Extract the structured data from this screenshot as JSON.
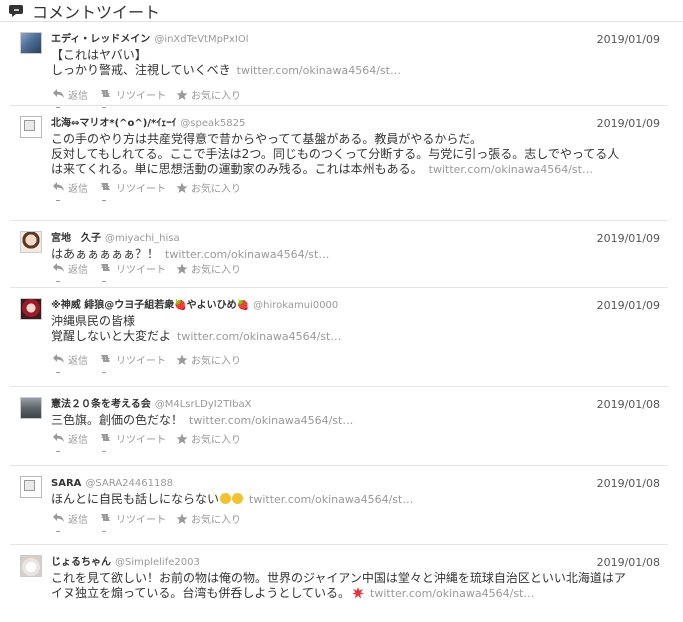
{
  "header": {
    "title": "コメントツイート",
    "icon": "speech-bubble-icon"
  },
  "actions": {
    "reply": "返信",
    "retweet": "リツイート",
    "favorite": "お気に入り"
  },
  "tweets": [
    {
      "name": "エディ・レッドメイン",
      "handle": "@inXdTeVtMpPxIOl",
      "date": "2019/01/09",
      "lines": [
        "【これはヤバい】",
        "しっかり警戒、注視していくべき"
      ],
      "link": "twitter.com/okinawa4564/st…",
      "avatar": "photo"
    },
    {
      "name": "北海⇔マリオ*(^o^)/*ｲｪｰｲ",
      "handle": "@speak5825",
      "date": "2019/01/09",
      "lines": [
        "この手のやり方は共産党得意で昔からやってて基盤がある。教員がやるからだ。",
        "反対してもしれてる。ここで手法は2つ。同じものつくって分断する。与党に引っ張る。志しでやってる人",
        "は来てくれる。単に思想活動の運動家のみ残る。これは本州もある。"
      ],
      "link": "twitter.com/okinawa4564/st…",
      "avatar": "broken"
    },
    {
      "name": "宮地　久子",
      "handle": "@miyachi_hisa",
      "date": "2019/01/09",
      "lines": [
        "はあぁぁぁぁぁ？！"
      ],
      "link": "twitter.com/okinawa4564/st…",
      "avatar": "photo"
    },
    {
      "name": "※神威 緋狼@ウヨ子組若衆🍓やよいひめ🍓",
      "handle": "@hirokamui0000",
      "date": "2019/01/09",
      "lines": [
        "沖縄県民の皆様",
        "覚醒しないと大変だよ"
      ],
      "link": "twitter.com/okinawa4564/st…",
      "avatar": "photo"
    },
    {
      "name": "憲法２０条を考える会",
      "handle": "@M4LsrLDyI2TIbaX",
      "date": "2019/01/08",
      "lines": [
        "三色旗。創価の色だな！"
      ],
      "link": "twitter.com/okinawa4564/st…",
      "avatar": "photo"
    },
    {
      "name": "SARA",
      "handle": "@SARA24461188",
      "date": "2019/01/08",
      "lines": [
        "ほんとに自民も話しにならない"
      ],
      "link": "twitter.com/okinawa4564/st…",
      "avatar": "broken"
    },
    {
      "name": "じょるちゃん",
      "handle": "@Simplelife2003",
      "date": "2019/01/08",
      "lines": [
        "これを見て欲しい！お前の物は俺の物。世界のジャイアン中国は堂々と沖縄を琉球自治区といい北海道はア",
        "イヌ独立を煽っている。台湾も併呑しようとしている。"
      ],
      "link": "twitter.com/okinawa4564/st…",
      "avatar": "photo"
    }
  ],
  "colors": {
    "name": "#333333",
    "muted": "#999999",
    "border": "#e5e5e5"
  }
}
